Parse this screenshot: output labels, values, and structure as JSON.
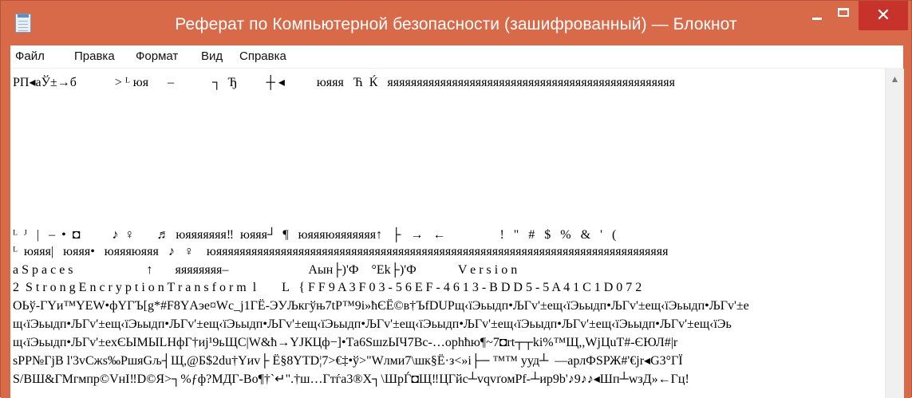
{
  "window": {
    "title": "Реферат по Компьютерной безопасности (зашифрованный) — Блокнот",
    "minimize_glyph": "",
    "maximize_glyph": "",
    "close_glyph": "✕",
    "accent_color": "#d86a4a",
    "close_color": "#c7332b"
  },
  "menu": {
    "items": [
      "Файл",
      "Правка",
      "Формат",
      "Вид",
      "Справка"
    ]
  },
  "editor": {
    "lines": [
      "РП◂аЎ±→б            > ᴸ юя      –            ┐  Ђ         ┼ ◂          юяяя   Ћ  Ќ   яяяяяяяяяяяяяяяяяяяяяяяяяяяяяяяяяяяяяяяяяяяяяяяяя",
      "ᴸ  ᴶ   |   –  •  ◘          ♪  ♀       ♬  юяяяяяяя‼  юяяя┘  ¶   юяяяюяяяяяяя↑   ├   →   ←                 !   \"   #   $   %   &   '   (",
      "ᴸ  юяяя|   юяяя•   юяяяюяяя   ♪   ♀    юяяяяяяяяяяяяяяяяяяяяяяяяяяяяяяяяяяяяяяяяяяяяяяяяяяяяяяяяяяяяяяяяяяяяяяяяяяяяя",
      "a S p a c e s                       ↑       яяяяяяяя–                         Аын├)'Ф    °Ek├)'Ф             V e r s i o n",
      "2  S t r o n g E n c r y p t i o n T r a n s f o r m  l        L   { F F 9 A 3 F 0 3 - 5 6 E F - 4 6 1 3 - B D D 5 - 5 A 4 1 C 1 D 0 7 2",
      "OЬў-ГYи™YEW•фYГЪ[g*#F8YАэе¤Wc_j1ГЁ-ЭУЉкгўњ7tP™9i»ћЄЁ©в†ЪfDUРщ‹ïЭьыдп•ЉГv'±ещ‹ïЭьыдп•ЉГv'±ещ‹ïЭьыдп•ЉГv'±е",
      "щ‹ïЭьыдп•ЉГv'±ещ‹ïЭьыдп•ЉГv'±ещ‹ïЭьыдп•ЉГv'±ещ‹ïЭьыдп•ЉГv'±ещ‹ïЭьыдп•ЉГv'±ещ‹ïЭьыдп•ЉГv'±ещ‹ïЭьыдп•ЉГv'±ещ‹ïЭь",
      "щ‹ïЭьыдп•ЉГv'±еxЄЫМЫLНфГ†иј¹9ьЩС|W&ћ→YJКЦф−]•Та6SшzЫЧ7Вс-…орhћю¶~7◘rt┬┬ki%™Щ,,WjЦuТ#-ЄЮЛ#|r",
      "sPP№ГjВ l'3vCжs‰РшяGљ┤Щ,@Б$2du†Yиv├ Ё§8YТD¦7>€‡•ў>\"Wлми7\\шк§Ё·з<»i├─ ™™ ууд┴  —арлФSРЖ#'€јr◂G3°ГЇ",
      "S/ВШ&ГМгмпр©VнI‼D©Я>┐%ƒф?МДГ-Во¶†`↵\".†ш…Гтѓа3®Х┐\\ШрЃ◘Щ‼ЦГйс┴vqvґомPf-┴ир9b'♪9♪♪◂Шп┴wзД»←Гц!"
    ]
  },
  "scrollbar": {
    "up_arrow": "▲"
  }
}
